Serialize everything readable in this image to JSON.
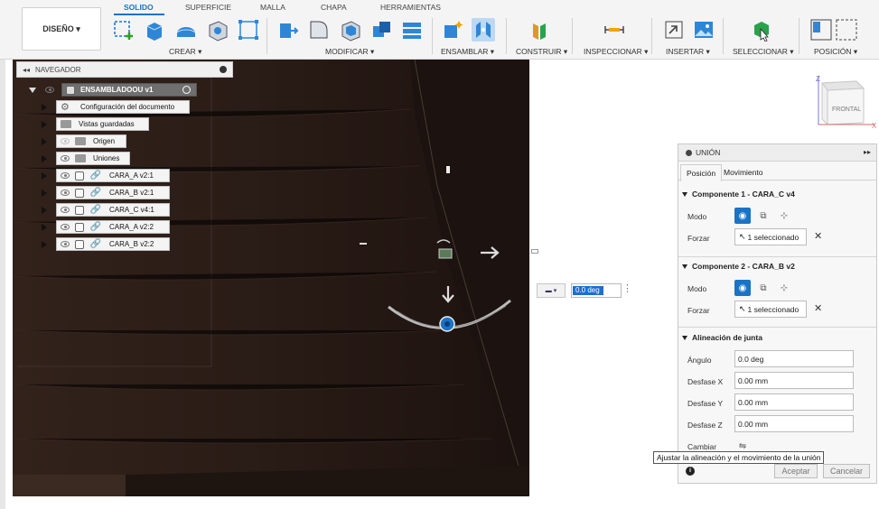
{
  "toolbar": {
    "design_label": "DISEÑO ▾",
    "tabs": [
      "SOLIDO",
      "SUPERFICIE",
      "MALLA",
      "CHAPA",
      "HERRAMIENTAS"
    ],
    "groups": [
      "CREAR ▾",
      "MODIFICAR ▾",
      "ENSAMBLAR ▾",
      "CONSTRUIR ▾",
      "INSPECCIONAR ▾",
      "INSERTAR ▾",
      "SELECCIONAR ▾",
      "POSICIÓN ▾"
    ]
  },
  "navigator": {
    "title": "NAVEGADOR",
    "root": "ENSAMBLADOOU v1",
    "items": [
      {
        "label": "Configuración del documento",
        "icon": "gear-icon"
      },
      {
        "label": "Vistas guardadas",
        "icon": "folder-icon"
      },
      {
        "label": "Origen",
        "icon": "folder-icon"
      },
      {
        "label": "Uniones",
        "icon": "folder-icon"
      },
      {
        "label": "CARA_A v2:1",
        "icon": "component-link-icon"
      },
      {
        "label": "CARA_B v2:1",
        "icon": "component-link-icon"
      },
      {
        "label": "CARA_C v4:1",
        "icon": "component-link-icon"
      },
      {
        "label": "CARA_A v2:2",
        "icon": "component-link-icon"
      },
      {
        "label": "CARA_B v2:2",
        "icon": "component-link-icon"
      }
    ]
  },
  "viewcube": {
    "face": "FRONTAL",
    "axis_z": "Z",
    "axis_x": "X"
  },
  "angle_input": {
    "value": "0.0 deg"
  },
  "joint_panel": {
    "title": "UNIÓN",
    "tabs": [
      "Posición",
      "Movimiento"
    ],
    "component1": {
      "title": "Componente 1 - CARA_C v4",
      "mode_label": "Modo",
      "snap_label": "Forzar",
      "selection": "1 seleccionado"
    },
    "component2": {
      "title": "Componente 2 - CARA_B v2",
      "mode_label": "Modo",
      "snap_label": "Forzar",
      "selection": "1 seleccionado"
    },
    "alignment": {
      "title": "Alineación de junta",
      "angle_label": "Ángulo",
      "angle_value": "0.0 deg",
      "offset_x_label": "Desfase X",
      "offset_x_value": "0.00 mm",
      "offset_y_label": "Desfase Y",
      "offset_y_value": "0.00 mm",
      "offset_z_label": "Desfase Z",
      "offset_z_value": "0.00 mm",
      "flip_label": "Cambiar"
    },
    "ok_label": "Aceptar",
    "cancel_label": "Cancelar"
  },
  "tooltip": "Ajustar la alineación y el movimiento de la unión",
  "colors": {
    "accent": "#1a73c6",
    "wood_dark": "#2a1c16",
    "toolbar_bg": "#f4f4f4"
  }
}
